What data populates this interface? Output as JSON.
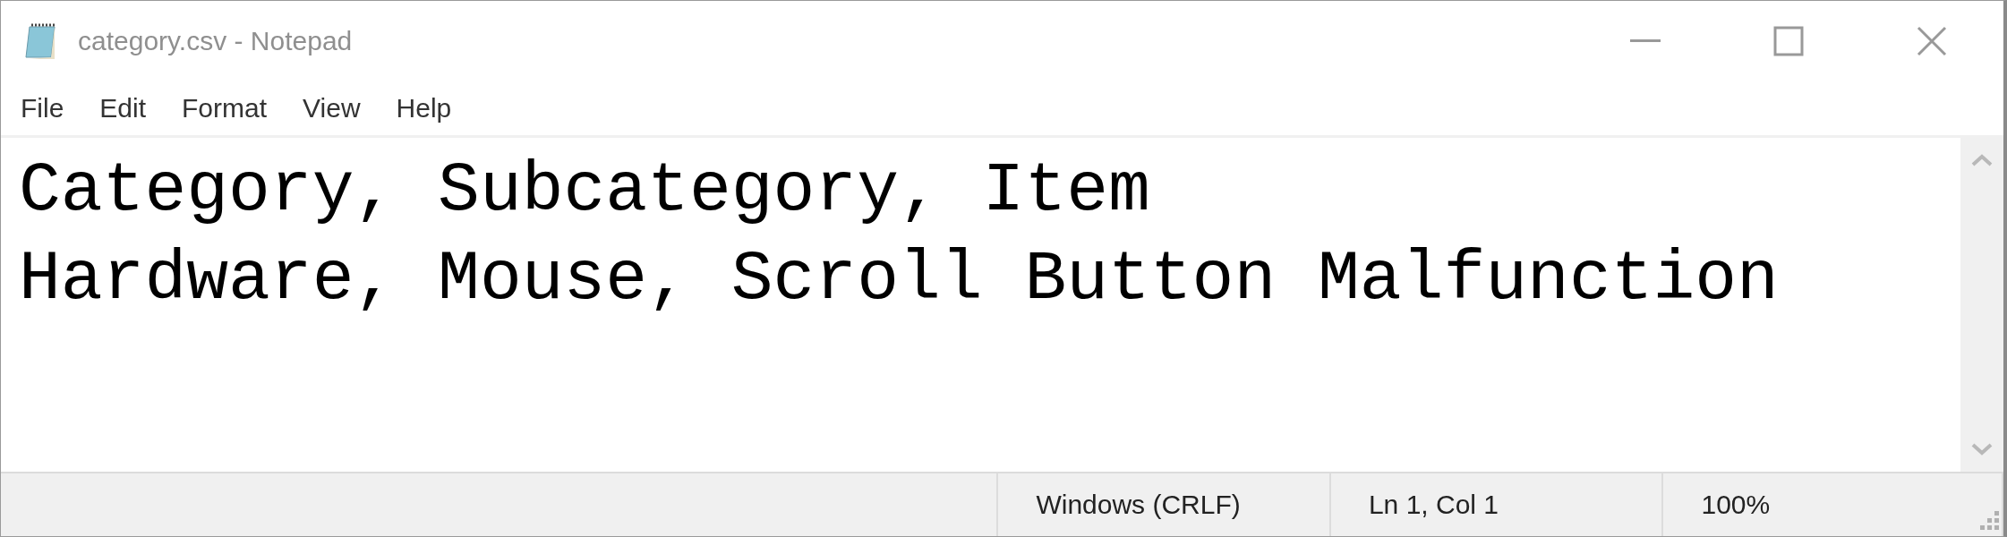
{
  "window": {
    "title": "category.csv - Notepad"
  },
  "menu": [
    "File",
    "Edit",
    "Format",
    "View",
    "Help"
  ],
  "editor": {
    "lines": [
      "Category, Subcategory, Item",
      "Hardware, Mouse, Scroll Button Malfunction"
    ]
  },
  "status_bar": [
    "Windows (CRLF)",
    "Ln 1, Col 1",
    "100%"
  ]
}
